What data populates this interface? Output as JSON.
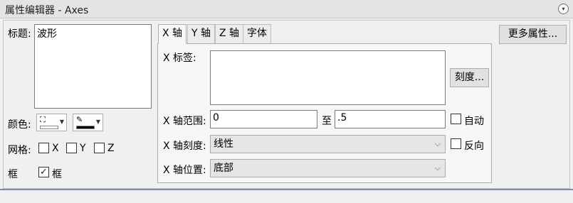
{
  "window": {
    "title": "属性编辑器 - Axes",
    "collapse_icon": "▾"
  },
  "left": {
    "title_label": "标题:",
    "title_value": "波形",
    "color_label": "颜色:",
    "fill_icon": "⛶",
    "line_icon": "✎",
    "fill_color": "#ffffff",
    "line_color": "#000000",
    "grid_label": "网格:",
    "grid_x": "X",
    "grid_y": "Y",
    "grid_z": "Z",
    "box_label": "框",
    "box_checkbox_label": "框",
    "box_checked_mark": "✓"
  },
  "tabs": [
    {
      "label": "X 轴",
      "active": true
    },
    {
      "label": "Y 轴",
      "active": false
    },
    {
      "label": "Z 轴",
      "active": false
    },
    {
      "label": "字体",
      "active": false
    }
  ],
  "xaxis": {
    "label_label": "X 标签:",
    "label_value": "",
    "ticks_button": "刻度...",
    "range_label": "X 轴范围:",
    "range_min": "0",
    "range_to": "至",
    "range_max": ".5",
    "auto_label": "自动",
    "scale_label": "X 轴刻度:",
    "scale_value": "线性",
    "reverse_label": "反向",
    "position_label": "X 轴位置:",
    "position_value": "底部"
  },
  "more_button": "更多属性...",
  "combo_arrow": "⌵"
}
